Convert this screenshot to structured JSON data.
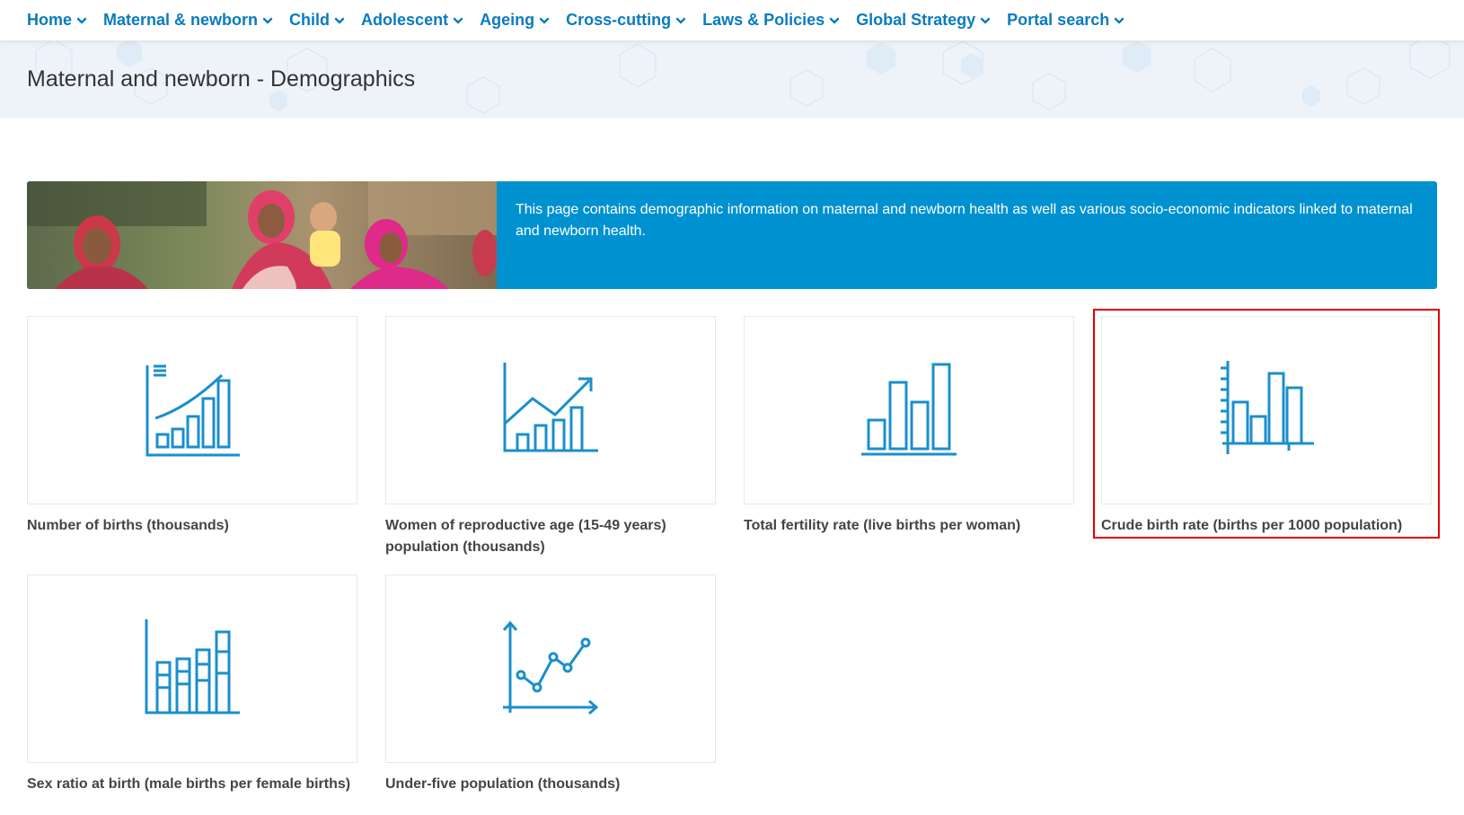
{
  "nav": {
    "items": [
      {
        "label": "Home"
      },
      {
        "label": "Maternal & newborn"
      },
      {
        "label": "Child"
      },
      {
        "label": "Adolescent"
      },
      {
        "label": "Ageing"
      },
      {
        "label": "Cross-cutting"
      },
      {
        "label": "Laws & Policies"
      },
      {
        "label": "Global Strategy"
      },
      {
        "label": "Portal search"
      }
    ]
  },
  "page": {
    "title": "Maternal and newborn - Demographics"
  },
  "banner": {
    "text": "This page contains demographic information on maternal and newborn health as well as various socio-economic indicators linked to maternal and newborn health."
  },
  "cards": [
    {
      "label": "Number of births (thousands)",
      "icon": "growth-bar-chart-icon"
    },
    {
      "label": "Women of reproductive age (15-49 years) population (thousands)",
      "icon": "trend-bar-chart-icon"
    },
    {
      "label": "Total fertility rate (live births per woman)",
      "icon": "bar-chart-icon"
    },
    {
      "label": "Crude birth rate (births per 1000 population)",
      "icon": "axis-bar-chart-icon"
    },
    {
      "label": "Sex ratio at birth (male births per female births)",
      "icon": "stacked-bar-chart-icon"
    },
    {
      "label": "Under-five population (thousands)",
      "icon": "line-chart-icon"
    }
  ],
  "colors": {
    "accent": "#0a7bbf",
    "icon": "#1a8fcc",
    "banner": "#0091d0",
    "highlight": "#e00000"
  }
}
